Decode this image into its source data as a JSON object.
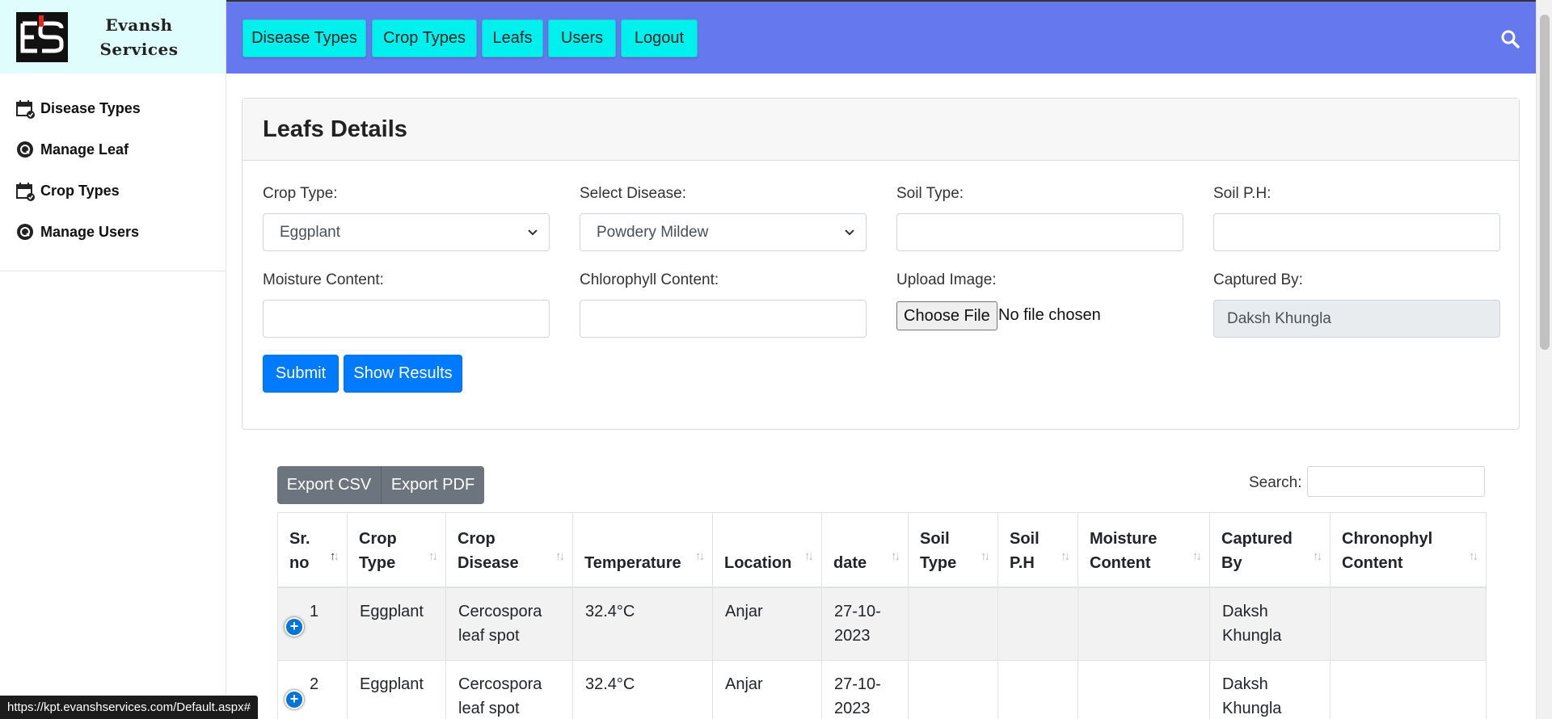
{
  "brand": {
    "line1": "Evansh",
    "line2": "Services"
  },
  "sidebar": {
    "items": [
      {
        "label": "Disease Types",
        "icon": "calendar-check-icon"
      },
      {
        "label": "Manage Leaf",
        "icon": "circle-q-icon"
      },
      {
        "label": "Crop Types",
        "icon": "calendar-check-icon"
      },
      {
        "label": "Manage Users",
        "icon": "circle-q-icon"
      }
    ]
  },
  "topnav": {
    "items": [
      "Disease Types",
      "Crop Types",
      "Leafs",
      "Users",
      "Logout"
    ],
    "search_icon": "search-icon"
  },
  "form": {
    "title": "Leafs Details",
    "crop_type_label": "Crop Type:",
    "crop_type_value": "Eggplant",
    "disease_label": "Select Disease:",
    "disease_value": "Powdery Mildew",
    "soil_type_label": "Soil Type:",
    "soil_type_value": "",
    "soil_ph_label": "Soil P.H:",
    "soil_ph_value": "",
    "moisture_label": "Moisture Content:",
    "moisture_value": "",
    "chlorophyll_label": "Chlorophyll Content:",
    "chlorophyll_value": "",
    "upload_label": "Upload Image:",
    "choose_file": "Choose File",
    "no_file": "No file chosen",
    "captured_label": "Captured By:",
    "captured_value": "Daksh Khungla",
    "submit": "Submit",
    "show_results": "Show Results"
  },
  "table_tools": {
    "export_csv": "Export CSV",
    "export_pdf": "Export PDF",
    "search_label": "Search:",
    "search_value": ""
  },
  "table": {
    "headers": [
      [
        "Sr.",
        "no"
      ],
      [
        "Crop",
        "Type"
      ],
      [
        "Crop",
        "Disease"
      ],
      [
        "Temperature"
      ],
      [
        "Location"
      ],
      [
        "date"
      ],
      [
        "Soil",
        "Type"
      ],
      [
        "Soil",
        "P.H"
      ],
      [
        "Moisture",
        "Content"
      ],
      [
        "Captured",
        "By"
      ],
      [
        "Chronophyl",
        "Content"
      ]
    ],
    "rows": [
      [
        "1",
        "Eggplant",
        [
          "Cercospora",
          "leaf spot"
        ],
        "32.4°C",
        "Anjar",
        [
          "27-10-",
          "2023"
        ],
        "",
        "",
        "",
        [
          "Daksh",
          "Khungla"
        ],
        ""
      ],
      [
        "2",
        "Eggplant",
        [
          "Cercospora",
          "leaf spot"
        ],
        "32.4°C",
        "Anjar",
        [
          "27-10-",
          "2023"
        ],
        "",
        "",
        "",
        [
          "Daksh",
          "Khungla"
        ],
        ""
      ]
    ]
  },
  "status_url": "https://kpt.evanshservices.com/Default.aspx#"
}
